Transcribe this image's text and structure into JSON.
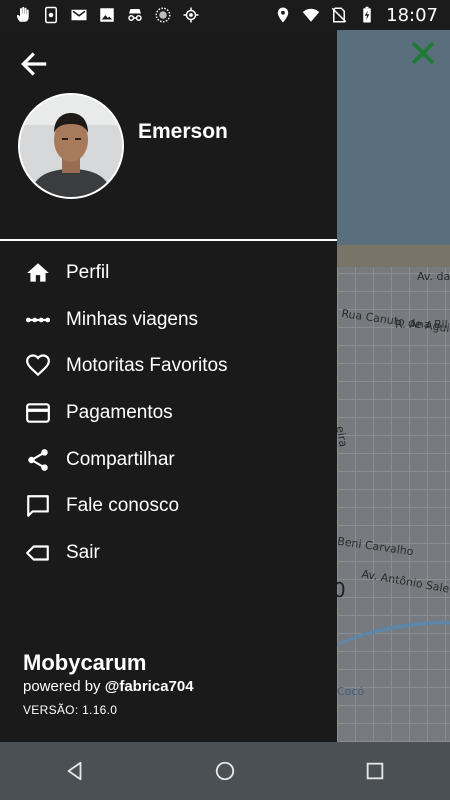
{
  "status_bar": {
    "time": "18:07",
    "left_icons": [
      "hand-icon",
      "phone-screen-icon",
      "gmail-icon",
      "image-icon",
      "incognito-icon",
      "circle-pattern-icon",
      "location-target-icon"
    ],
    "right_icons": [
      "location-icon",
      "wifi-icon",
      "no-sim-icon",
      "battery-charging-icon"
    ]
  },
  "drawer": {
    "user_name": "Emerson",
    "menu": [
      {
        "label": "Perfil",
        "icon": "home-icon"
      },
      {
        "label": "Minhas viagens",
        "icon": "dots-route-icon"
      },
      {
        "label": "Motoritas Favoritos",
        "icon": "heart-icon"
      },
      {
        "label": "Pagamentos",
        "icon": "credit-card-icon"
      },
      {
        "label": "Compartilhar",
        "icon": "share-icon"
      },
      {
        "label": "Fale conosco",
        "icon": "chat-icon"
      },
      {
        "label": "Sair",
        "icon": "logout-tag-icon"
      }
    ],
    "footer": {
      "app_name": "Mobycarum",
      "powered_prefix": "powered by ",
      "powered_brand": "@fabrica704",
      "version": "VERSÃO: 1.16.0"
    }
  },
  "map": {
    "labels": [
      "Av. da",
      "R. Ana Bil",
      "Rua Canuto de Aguia",
      "eira",
      "Beni Carvalho",
      "Av. Antônio Sale",
      "Cocó",
      "0"
    ]
  },
  "colors": {
    "drawer_bg": "#1a1a1a",
    "close_icon": "#1e7a35",
    "navbar_bg": "#4a5054"
  }
}
